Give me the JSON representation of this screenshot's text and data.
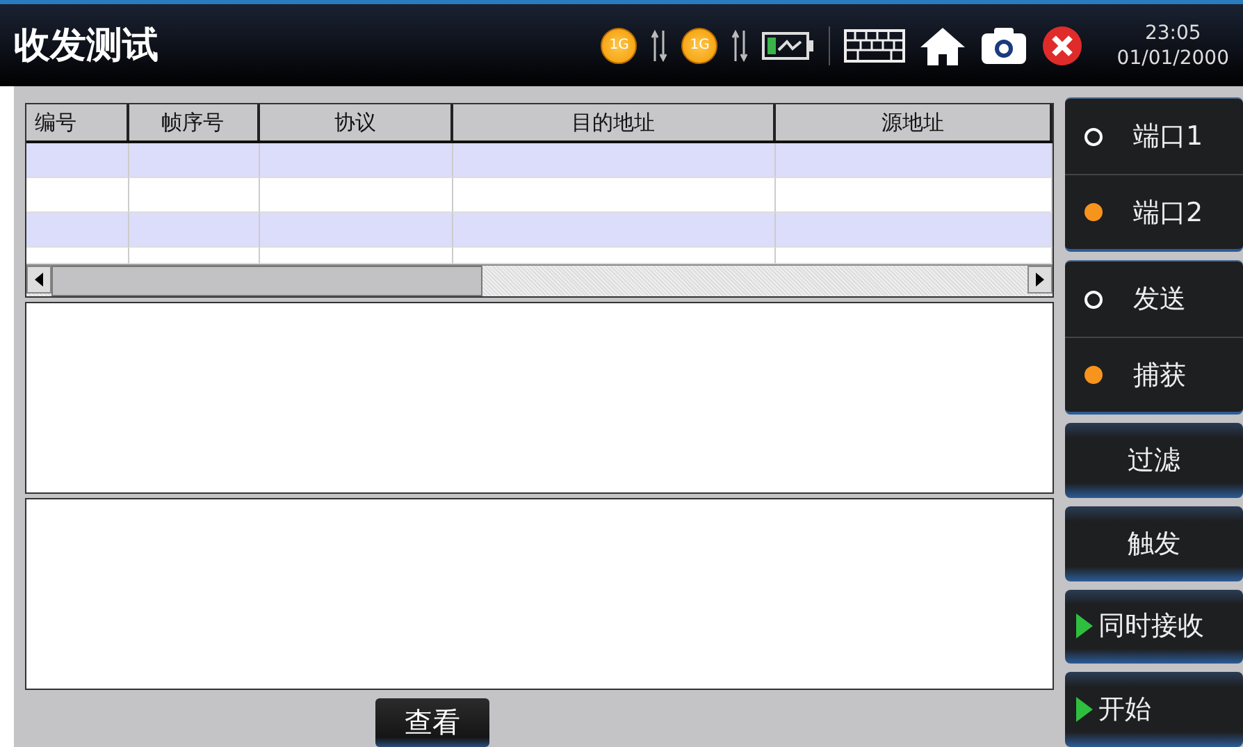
{
  "header": {
    "title": "收发测试",
    "ports": [
      {
        "label": "1G"
      },
      {
        "label": "1G"
      }
    ],
    "time": "23:05",
    "date": "01/01/2000"
  },
  "table": {
    "columns": [
      "编号",
      "帧序号",
      "协议",
      "目的地址",
      "源地址"
    ]
  },
  "view_button": "查看",
  "sidebar": {
    "radio_groups": [
      {
        "items": [
          {
            "label": "端口1",
            "selected": false
          },
          {
            "label": "端口2",
            "selected": true
          }
        ]
      },
      {
        "items": [
          {
            "label": "发送",
            "selected": false
          },
          {
            "label": "捕获",
            "selected": true
          }
        ]
      }
    ],
    "buttons": [
      {
        "label": "过滤",
        "kind": "plain"
      },
      {
        "label": "触发",
        "kind": "plain"
      },
      {
        "label": "同时接收",
        "kind": "play"
      },
      {
        "label": "开始",
        "kind": "play"
      }
    ]
  }
}
